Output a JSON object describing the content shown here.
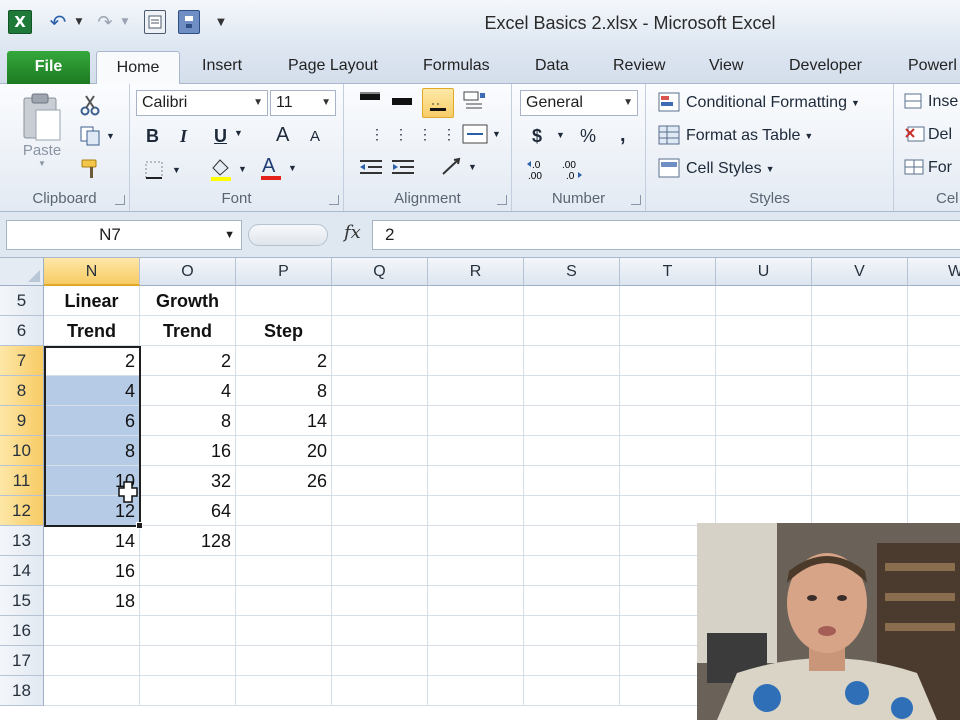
{
  "window": {
    "title": "Excel Basics 2.xlsx  -  Microsoft Excel",
    "app_icon": "excel-icon"
  },
  "tabs": [
    {
      "label": "File"
    },
    {
      "label": "Home"
    },
    {
      "label": "Insert"
    },
    {
      "label": "Page Layout"
    },
    {
      "label": "Formulas"
    },
    {
      "label": "Data"
    },
    {
      "label": "Review"
    },
    {
      "label": "View"
    },
    {
      "label": "Developer"
    },
    {
      "label": "Powerl"
    }
  ],
  "ribbon": {
    "clipboard": {
      "label": "Clipboard",
      "paste": "Paste"
    },
    "font": {
      "label": "Font",
      "name": "Calibri",
      "size": "11",
      "bold": "B",
      "italic": "I",
      "underline": "U",
      "grow": "A",
      "shrink": "A"
    },
    "alignment": {
      "label": "Alignment"
    },
    "number": {
      "label": "Number",
      "format": "General",
      "currency": "$",
      "percent": "%",
      "comma": ","
    },
    "styles": {
      "label": "Styles",
      "conditional": "Conditional Formatting",
      "table": "Format as Table",
      "cell_styles": "Cell Styles"
    },
    "cells": {
      "label": "Cel",
      "insert": "Inse",
      "delete": "Del",
      "format": "For"
    }
  },
  "formula_bar": {
    "name_box": "N7",
    "fx": "fx",
    "value": "2"
  },
  "grid": {
    "columns": [
      "N",
      "O",
      "P",
      "Q",
      "R",
      "S",
      "T",
      "U",
      "V",
      "W"
    ],
    "rows": [
      {
        "num": "5",
        "cells": [
          "Linear",
          "Growth",
          ""
        ]
      },
      {
        "num": "6",
        "cells": [
          "Trend",
          "Trend",
          "Step"
        ]
      },
      {
        "num": "7",
        "cells": [
          "2",
          "2",
          "2"
        ]
      },
      {
        "num": "8",
        "cells": [
          "4",
          "4",
          "8"
        ]
      },
      {
        "num": "9",
        "cells": [
          "6",
          "8",
          "14"
        ]
      },
      {
        "num": "10",
        "cells": [
          "8",
          "16",
          "20"
        ]
      },
      {
        "num": "11",
        "cells": [
          "10",
          "32",
          "26"
        ]
      },
      {
        "num": "12",
        "cells": [
          "12",
          "64",
          ""
        ]
      },
      {
        "num": "13",
        "cells": [
          "14",
          "128",
          ""
        ]
      },
      {
        "num": "14",
        "cells": [
          "16",
          "",
          ""
        ]
      },
      {
        "num": "15",
        "cells": [
          "18",
          "",
          ""
        ]
      },
      {
        "num": "16",
        "cells": [
          "",
          "",
          ""
        ]
      },
      {
        "num": "17",
        "cells": [
          "",
          "",
          ""
        ]
      },
      {
        "num": "18",
        "cells": [
          "",
          "",
          ""
        ]
      }
    ],
    "selection": "N7:N12",
    "selected_rows": [
      "7",
      "8",
      "9",
      "10",
      "11",
      "12"
    ],
    "selected_column": "N",
    "selection_color": "#b6cbe6"
  },
  "colors": {
    "file_tab": "#2e9a34",
    "selected_header": "#f8cb63"
  }
}
